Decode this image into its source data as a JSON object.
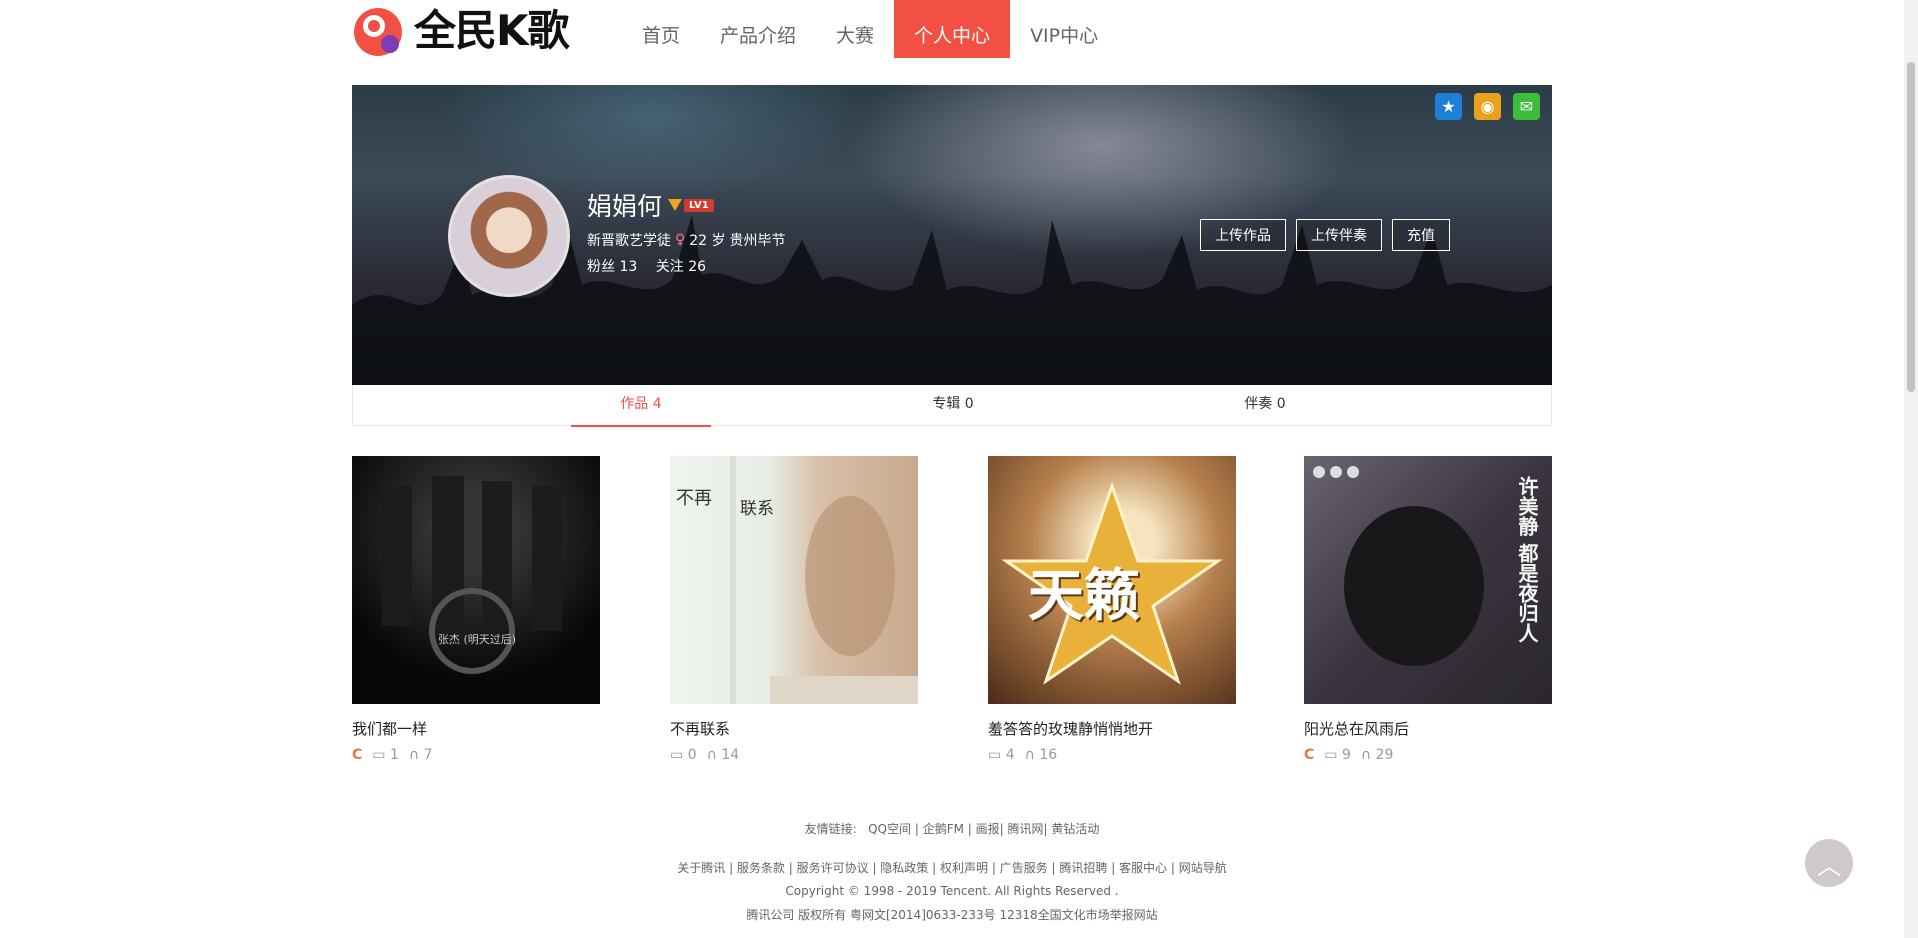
{
  "header": {
    "logo_text": "全民K歌",
    "nav": [
      "首页",
      "产品介绍",
      "大赛",
      "个人中心",
      "VIP中心"
    ],
    "active_nav": 3
  },
  "profile": {
    "name": "娟娟何",
    "level": "LV1",
    "title": "新晋歌艺学徒",
    "age": "22 岁",
    "location": "贵州毕节",
    "fans_label": "粉丝",
    "fans": "13",
    "follow_label": "关注",
    "follow": "26",
    "actions": [
      "上传作品",
      "上传伴奏",
      "充值"
    ]
  },
  "tabs": [
    {
      "label": "作品 4"
    },
    {
      "label": "专辑 0"
    },
    {
      "label": "伴奏 0"
    }
  ],
  "songs": [
    {
      "title": "我们都一样",
      "badge": "C",
      "comments": "1",
      "listens": "7",
      "cover_text": "张杰 (明天过后)"
    },
    {
      "title": "不再联系",
      "badge": "",
      "comments": "0",
      "listens": "14",
      "cover_text_a": "不再",
      "cover_text_b": "联系"
    },
    {
      "title": "羞答答的玫瑰静悄悄地开",
      "badge": "",
      "comments": "4",
      "listens": "16",
      "cover_text": "天籁"
    },
    {
      "title": "阳光总在风雨后",
      "badge": "C",
      "comments": "9",
      "listens": "29",
      "cover_text": "许美静 都是夜归人"
    }
  ],
  "footer": {
    "friends_label": "友情链接:",
    "friends": [
      "QQ空间",
      "企鹅FM",
      "画报",
      "腾讯网",
      "黄钻活动"
    ],
    "links": [
      "关于腾讯",
      "服务条款",
      "服务许可协议",
      "隐私政策",
      "权利声明",
      "广告服务",
      "腾讯招聘",
      "客服中心",
      "网站导航"
    ],
    "copyright": "Copyright © 1998 - 2019 Tencent. All Rights Reserved .",
    "company": "腾讯公司  版权所有  粤网文[2014]0633-233号  12318全国文化市场举报网站"
  },
  "colors": {
    "accent": "#f24f45",
    "qzone": "#1e7fd8",
    "weibo": "#e8a21e",
    "wechat": "#3fbd3a"
  }
}
